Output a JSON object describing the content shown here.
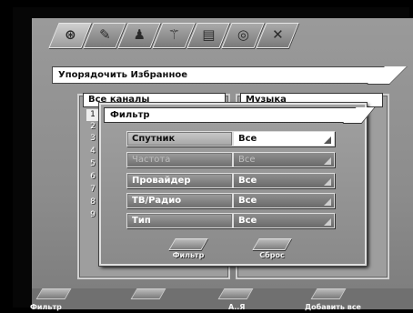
{
  "icons": [
    "satellite-icon",
    "wrench-icon",
    "user-icon",
    "antenna-icon",
    "folder-icon",
    "lock-icon",
    "tools-icon"
  ],
  "title": "Упорядочить Избранное",
  "lists": {
    "left_header": "Все каналы",
    "right_header": "Музыка"
  },
  "row_numbers": [
    "1",
    "2",
    "3",
    "4",
    "5",
    "6",
    "7",
    "8",
    "9"
  ],
  "dialog": {
    "title": "Фильтр",
    "rows": [
      {
        "label": "Спутник",
        "value": "Все",
        "state": "selected"
      },
      {
        "label": "Частота",
        "value": "Все",
        "state": "disabled"
      },
      {
        "label": "Провайдер",
        "value": "Все",
        "state": "normal"
      },
      {
        "label": "ТВ/Радио",
        "value": "Все",
        "state": "normal"
      },
      {
        "label": "Тип",
        "value": "Все",
        "state": "normal"
      }
    ],
    "buttons": {
      "filter": "Фильтр",
      "reset": "Сброс"
    }
  },
  "footer": {
    "btn1": "Фильтр",
    "btn2": "",
    "btn3": "А..Я",
    "btn4": "Добавить все"
  }
}
